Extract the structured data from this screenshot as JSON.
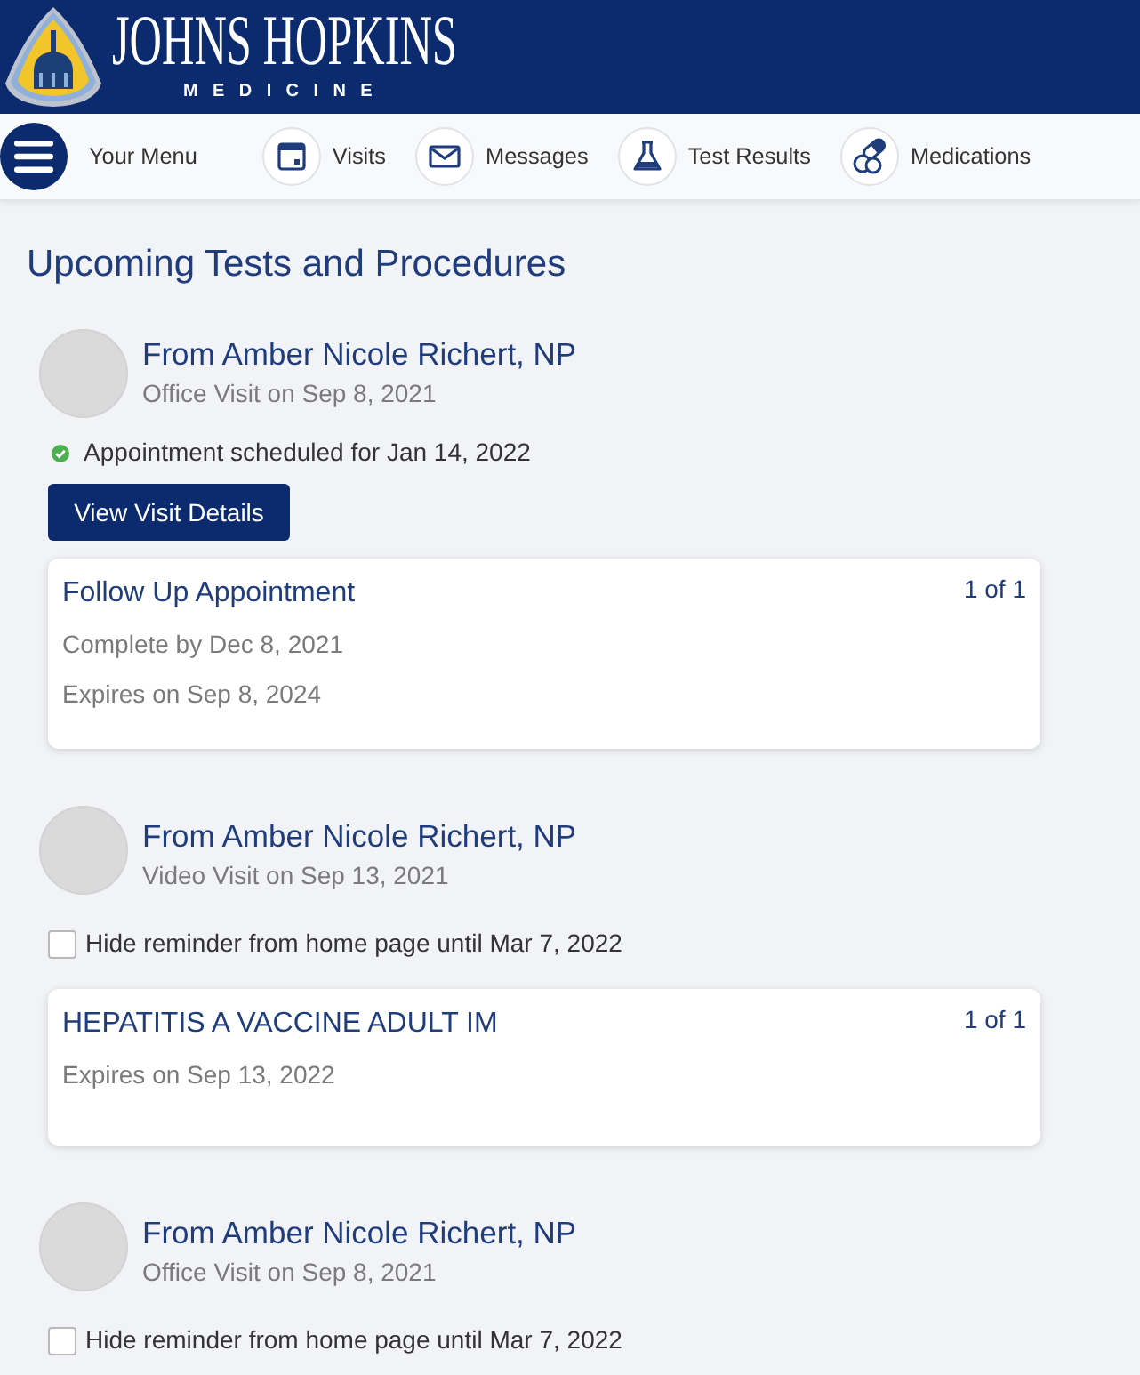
{
  "header": {
    "logo": {
      "title": "JOHNS HOPKINS",
      "subtitle": "MEDICINE"
    }
  },
  "nav": {
    "items": [
      {
        "kind": "menu",
        "label": "Your Menu"
      },
      {
        "kind": "visits",
        "label": "Visits"
      },
      {
        "kind": "messages",
        "label": "Messages"
      },
      {
        "kind": "tests",
        "label": "Test Results"
      },
      {
        "kind": "medications",
        "label": "Medications"
      }
    ]
  },
  "page": {
    "title": "Upcoming Tests and Procedures"
  },
  "reminders": [
    {
      "provider": "From Amber Nicole Richert, NP",
      "visit": "Office Visit on Sep 8, 2021",
      "status": "Appointment scheduled for Jan 14, 2022",
      "button": "View Visit Details",
      "order": {
        "title": "Follow Up Appointment",
        "count": "1 of 1",
        "details": [
          "Complete by Dec 8, 2021",
          "Expires on Sep 8, 2024"
        ]
      }
    },
    {
      "provider": "From Amber Nicole Richert, NP",
      "visit": "Video Visit on Sep 13, 2021",
      "hide": {
        "label": "Hide reminder from home page until Mar 7, 2022",
        "checked": false
      },
      "order": {
        "title": "HEPATITIS A VACCINE ADULT IM",
        "count": "1 of 1",
        "details": [
          "Expires on Sep 13, 2022"
        ]
      }
    },
    {
      "provider": "From Amber Nicole Richert, NP",
      "visit": "Office Visit on Sep 8, 2021",
      "hide": {
        "label": "Hide reminder from home page until Mar 7, 2022",
        "checked": false
      }
    }
  ]
}
